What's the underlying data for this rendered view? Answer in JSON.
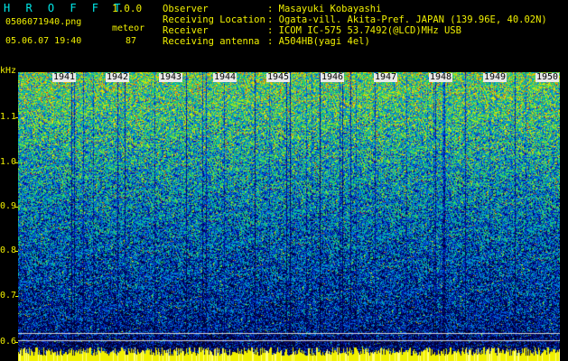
{
  "app": {
    "brand": "H R O F F T",
    "version": "1.0.0"
  },
  "file": {
    "name": "0506071940.png",
    "datetime": "05.06.07 19:40",
    "meteor_label": "meteor",
    "meteor_count": "87"
  },
  "info": [
    {
      "label": "Observer",
      "value": ": Masayuki Kobayashi"
    },
    {
      "label": "Receiving Location",
      "value": ": Ogata-vill. Akita-Pref. JAPAN (139.96E, 40.02N)"
    },
    {
      "label": "Receiver",
      "value": ": ICOM IC-575 53.7492(@LCD)MHz USB"
    },
    {
      "label": "Receiving antenna",
      "value": ": A504HB(yagi 4el)"
    }
  ],
  "axis": {
    "unit": "kHz",
    "freq_ticks": [
      "1.1",
      "1.0",
      "0.9",
      "0.8",
      "0.7",
      "0.6"
    ],
    "hour_labels": [
      "1941",
      "1942",
      "1943",
      "1944",
      "1945",
      "1946",
      "1947",
      "1948",
      "1949",
      "1950"
    ]
  },
  "colors": {
    "text_cyan": "#00e8e8",
    "text_yellow": "#f0f000",
    "background": "#000000"
  }
}
